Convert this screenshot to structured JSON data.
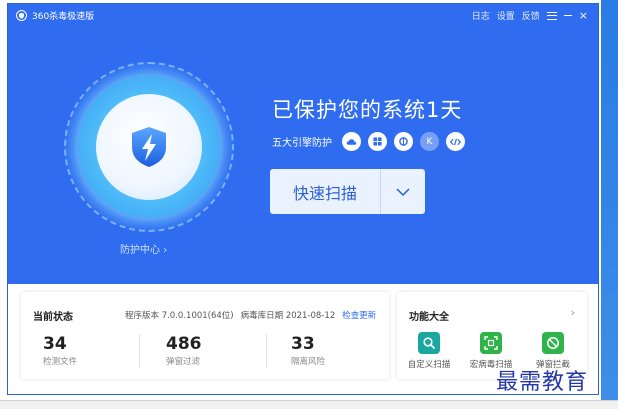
{
  "window": {
    "title": "360杀毒极速版",
    "links": [
      "日志",
      "设置",
      "反馈"
    ],
    "menu_icon": "hamburger-icon",
    "minimize_icon": "minimize-icon",
    "close_label": "×"
  },
  "protection": {
    "status_title": "已保护您的系统1天",
    "engines_label": "五大引擎防护",
    "engine_icons": [
      "cloud-icon",
      "windows-icon",
      "qvm-icon",
      "k-icon",
      "code-icon"
    ],
    "engine_k_label": "K",
    "center_link": "防护中心",
    "center_chevron": "›"
  },
  "scan": {
    "label": "快速扫描",
    "dropdown_icon": "chevron-down-icon"
  },
  "status_card": {
    "title": "当前状态",
    "program_version": "程序版本 7.0.0.1001(64位)",
    "virus_db_date": "病毒库日期 2021-08-12",
    "check_update": "检查更新",
    "stats": [
      {
        "value": "34",
        "label": "检测文件"
      },
      {
        "value": "486",
        "label": "弹窗过滤"
      },
      {
        "value": "33",
        "label": "隔离风险"
      }
    ]
  },
  "function_card": {
    "title": "功能大全",
    "more": "›",
    "tools": [
      {
        "label": "自定义扫描",
        "icon": "custom-scan-icon",
        "color": "#1aa7a0"
      },
      {
        "label": "宏病毒扫描",
        "icon": "macro-scan-icon",
        "color": "#2fb34a"
      },
      {
        "label": "弹窗拦截",
        "icon": "popup-block-icon",
        "color": "#2fb34a"
      }
    ]
  },
  "watermark": "最需教育",
  "colors": {
    "primary_blue": "#2f6cf0",
    "scan_button_bg": "#eaf1ff",
    "scan_text": "#2b5fd8"
  }
}
